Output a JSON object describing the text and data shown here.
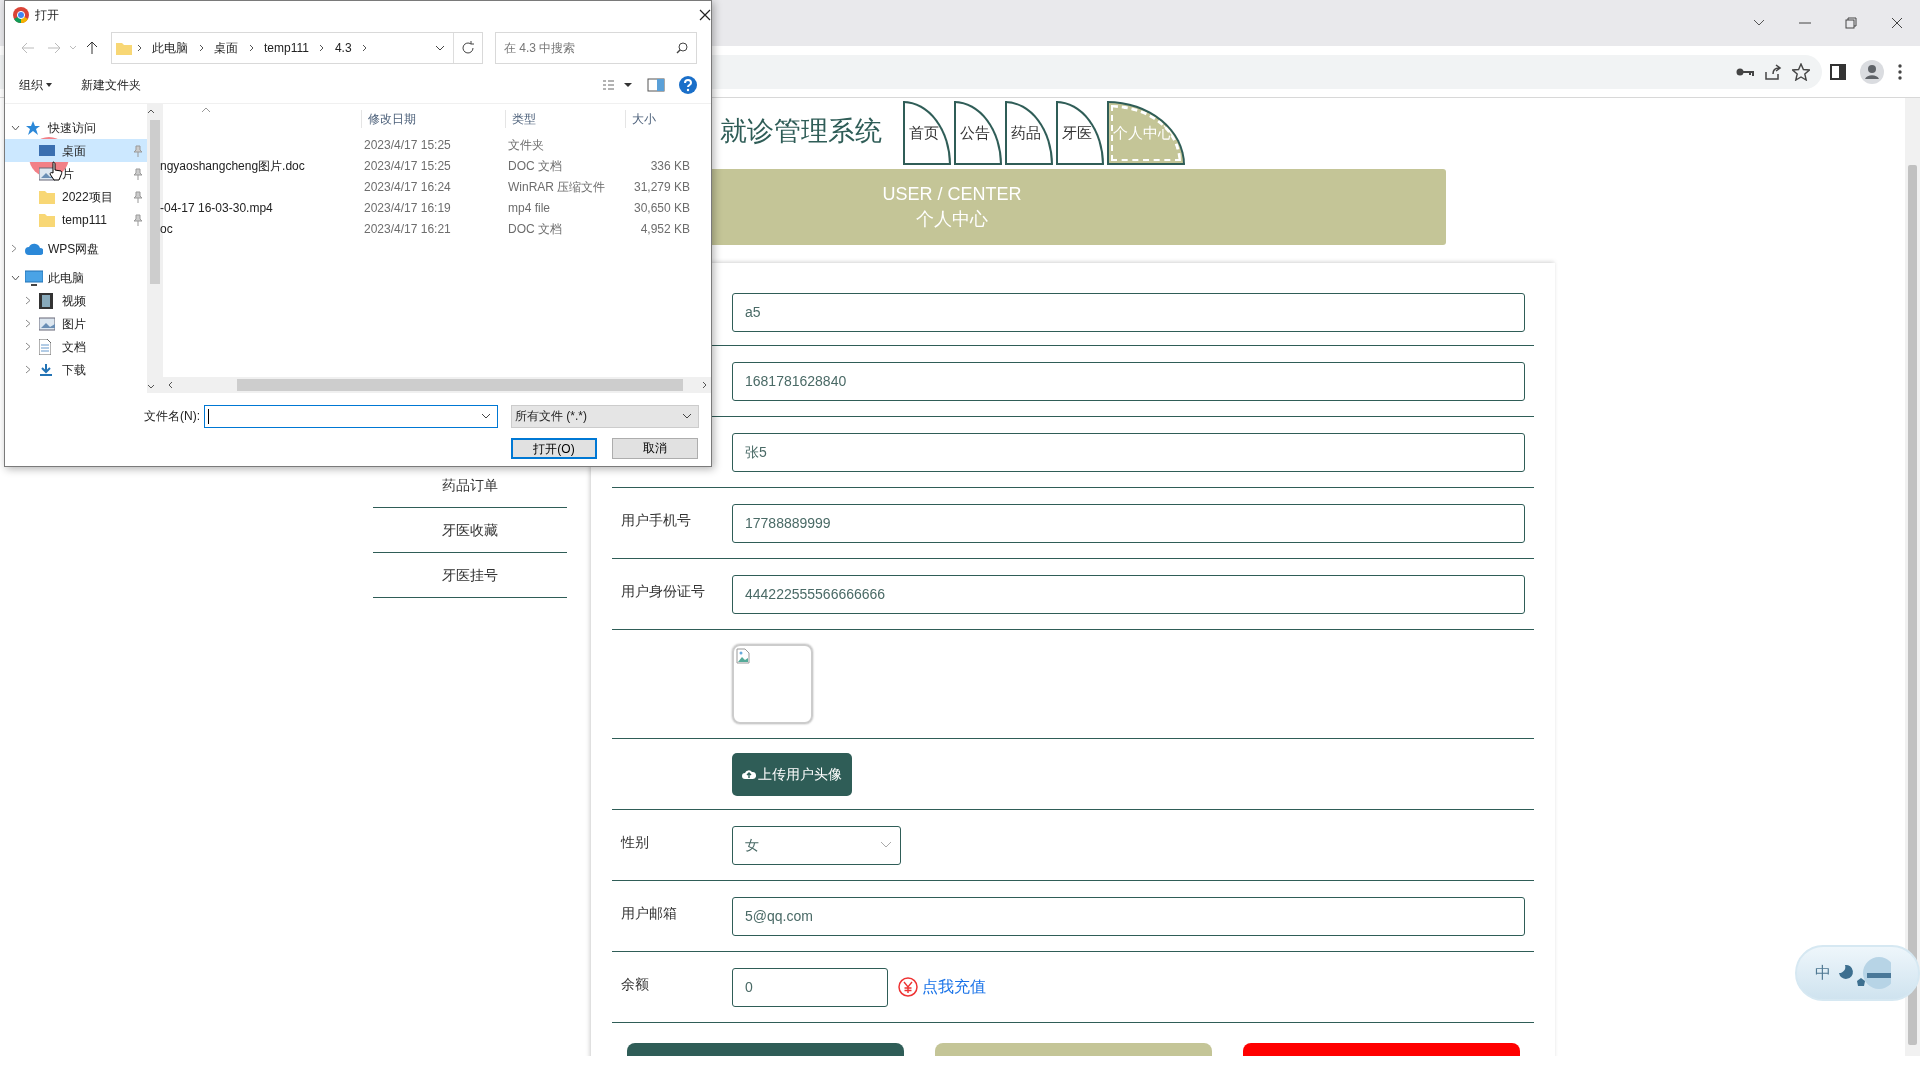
{
  "dialog": {
    "title": "打开",
    "breadcrumbs": [
      "此电脑",
      "桌面",
      "temp111",
      "4.3"
    ],
    "search": {
      "placeholder": "在 4.3 中搜索"
    },
    "toolbar": [
      {
        "label": "组织",
        "dropdown": true
      },
      {
        "label": "新建文件夹",
        "dropdown": false
      }
    ],
    "tree": [
      {
        "label": "快速访问",
        "kind": "star",
        "expanded": true,
        "children": [
          {
            "label": "桌面",
            "kind": "desktop",
            "selected": true,
            "pinned": true
          },
          {
            "label": "片",
            "kind": "pictures",
            "selected": false,
            "pinned": true
          },
          {
            "label": "2022项目",
            "kind": "folder",
            "selected": false,
            "pinned": true
          },
          {
            "label": "temp111",
            "kind": "folder",
            "selected": false,
            "pinned": true
          }
        ]
      },
      {
        "label": "WPS网盘",
        "kind": "cloud",
        "expanded": false
      },
      {
        "label": "此电脑",
        "kind": "computer",
        "expanded": true,
        "children": [
          {
            "label": "视频",
            "kind": "video",
            "expanded": false
          },
          {
            "label": "图片",
            "kind": "pictures",
            "expanded": false
          },
          {
            "label": "文档",
            "kind": "document",
            "expanded": false
          },
          {
            "label": "下载",
            "kind": "download",
            "expanded": false
          }
        ]
      }
    ],
    "columns": [
      "修改日期",
      "类型",
      "大小"
    ],
    "files": [
      {
        "modified": "2023/4/17 15:25",
        "type": "文件夹"
      },
      {
        "name": "ngyaoshangcheng图片.doc",
        "modified": "2023/4/17 15:25",
        "type": "DOC 文档",
        "size": "336 KB"
      },
      {
        "modified": "2023/4/17 16:24",
        "type": "WinRAR 压缩文件",
        "size": "31,279 KB"
      },
      {
        "name": "-04-17 16-03-30.mp4",
        "modified": "2023/4/17 16:19",
        "type": "mp4 file",
        "size": "30,650 KB"
      },
      {
        "name": "oc",
        "modified": "2023/4/17 16:21",
        "type": "DOC 文档",
        "size": "4,952 KB"
      }
    ],
    "filename_label": "文件名(N):",
    "filter": "所有文件 (*.*)",
    "buttons": [
      {
        "label": "打开(O)",
        "default": true
      },
      {
        "label": "取消",
        "default": false
      }
    ]
  },
  "page": {
    "title": "就诊管理系统",
    "nav": [
      {
        "label": "首页",
        "selected": false
      },
      {
        "label": "公告",
        "selected": false
      },
      {
        "label": "药品",
        "selected": false
      },
      {
        "label": "牙医",
        "selected": false
      },
      {
        "label": "个人中心",
        "selected": true
      }
    ],
    "banner": {
      "title": "USER / CENTER",
      "subtitle": "个人中心"
    },
    "sidebar": [
      "药品订单",
      "牙医收藏",
      "牙医挂号"
    ],
    "form": {
      "rows": [
        {
          "kind": "input",
          "value": "a5"
        },
        {
          "kind": "input",
          "value": "1681781628840"
        },
        {
          "kind": "input",
          "value": "张5"
        },
        {
          "kind": "input",
          "label": "用户手机号",
          "value": "17788889999"
        },
        {
          "kind": "input",
          "label": "用户身份证号",
          "value": "444222555566666666"
        },
        {
          "kind": "image"
        },
        {
          "kind": "upload",
          "button": "上传用户头像"
        },
        {
          "kind": "select",
          "label": "性别",
          "value": "女"
        },
        {
          "kind": "input",
          "label": "用户邮箱",
          "value": "5@qq.com"
        },
        {
          "kind": "balance",
          "label": "余额",
          "value": "0",
          "link": "点我充值"
        }
      ],
      "buttons": [
        {
          "color": "#2f5d57"
        },
        {
          "color": "#c4c597"
        },
        {
          "color": "#ff0000"
        }
      ]
    }
  },
  "ime": "中"
}
